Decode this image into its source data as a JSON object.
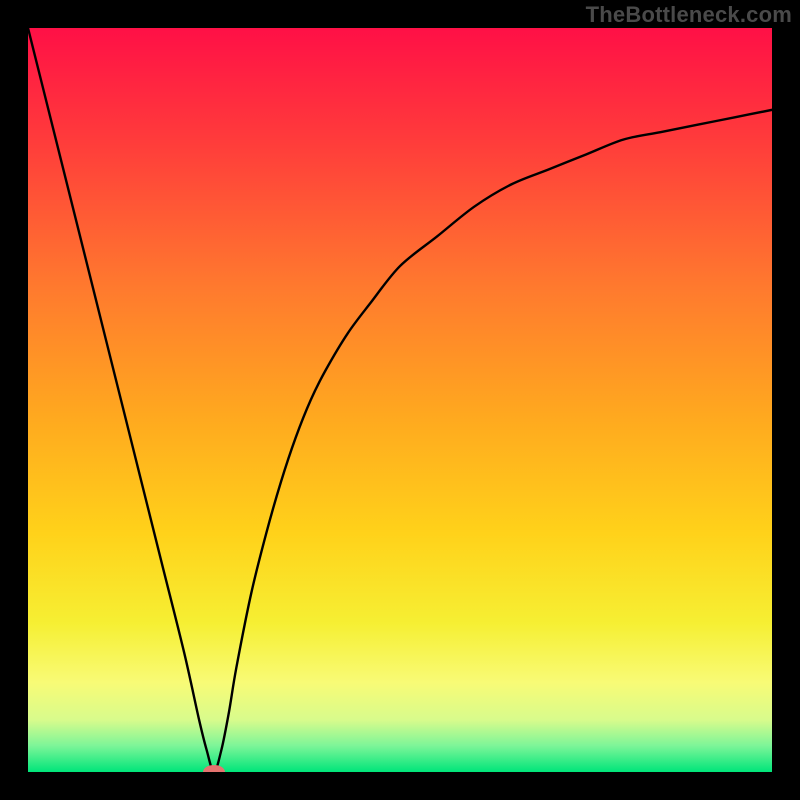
{
  "watermark": "TheBottleneck.com",
  "chart_data": {
    "type": "line",
    "title": "",
    "xlabel": "",
    "ylabel": "",
    "xlim": [
      0,
      100
    ],
    "ylim": [
      0,
      100
    ],
    "grid": false,
    "legend": false,
    "background_gradient": {
      "stops": [
        {
          "offset": 0.0,
          "color": "#ff1046"
        },
        {
          "offset": 0.15,
          "color": "#ff3b3b"
        },
        {
          "offset": 0.35,
          "color": "#ff7a2e"
        },
        {
          "offset": 0.52,
          "color": "#ffa81f"
        },
        {
          "offset": 0.68,
          "color": "#ffd21a"
        },
        {
          "offset": 0.8,
          "color": "#f6ef33"
        },
        {
          "offset": 0.88,
          "color": "#f8fb76"
        },
        {
          "offset": 0.93,
          "color": "#d8fb8c"
        },
        {
          "offset": 0.965,
          "color": "#7cf598"
        },
        {
          "offset": 1.0,
          "color": "#00e57a"
        }
      ]
    },
    "series": [
      {
        "name": "curve",
        "color": "#000000",
        "x": [
          0,
          3,
          6,
          9,
          12,
          15,
          18,
          21,
          23,
          24,
          25,
          26,
          27,
          28,
          30,
          32,
          34,
          36,
          38,
          40,
          43,
          46,
          50,
          55,
          60,
          65,
          70,
          75,
          80,
          85,
          90,
          95,
          100
        ],
        "y": [
          100,
          88,
          76,
          64,
          52,
          40,
          28,
          16,
          7,
          3,
          0,
          3,
          8,
          14,
          24,
          32,
          39,
          45,
          50,
          54,
          59,
          63,
          68,
          72,
          76,
          79,
          81,
          83,
          85,
          86,
          87,
          88,
          89
        ]
      }
    ],
    "marker": {
      "x": 25,
      "y": 0,
      "color": "#e5736f",
      "rx": 11,
      "ry": 7
    }
  }
}
